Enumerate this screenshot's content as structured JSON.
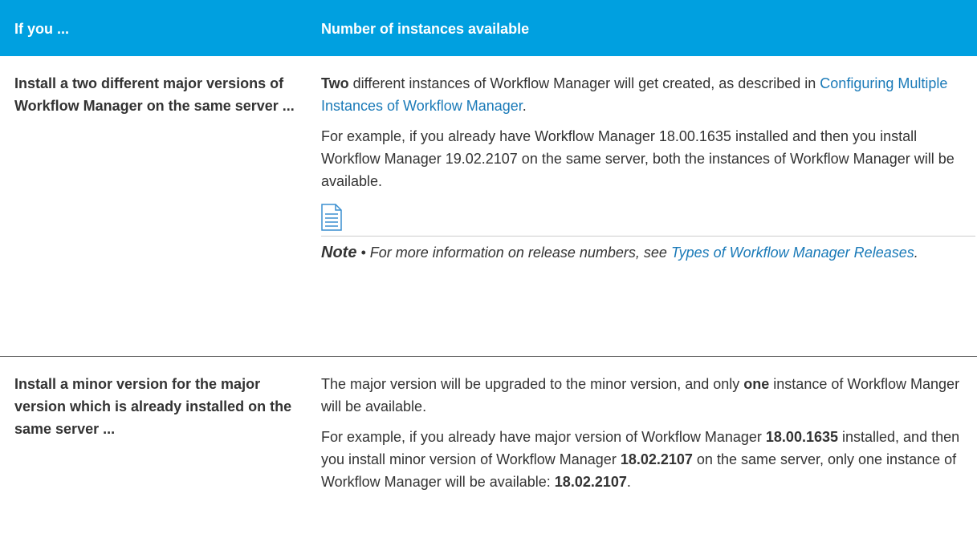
{
  "table": {
    "header": {
      "col1": "If you ...",
      "col2": "Number of instances available"
    },
    "rows": [
      {
        "condition": "Install a two different major versions of Workflow Manager on the same server ...",
        "p1_bold": "Two",
        "p1_text": " different instances of Workflow Manager will get created, as described in ",
        "p1_link": "Configuring Multiple Instances of Workflow Manager",
        "p1_end": ".",
        "p2": "For example, if you already have Workflow Manager 18.00.1635 installed and then you install Workflow Manager 19.02.2107 on the same server, both the instances of Workflow Manager will be available.",
        "note": {
          "icon": "note-document-icon",
          "label": "Note",
          "separator": " • ",
          "text": "For more information on release numbers, see ",
          "link": "Types of Workflow Manager Releases",
          "end": "."
        }
      },
      {
        "condition": "Install a minor version for the major version which is already installed on the same server ...",
        "p1_text": "The major version will be upgraded to the minor version, and only ",
        "p1_bold": "one",
        "p1_end": " instance of Workflow Manger will be available.",
        "p2_a": "For example, if you already have major version of Workflow Manager ",
        "p2_b1": "18.00.1635",
        "p2_c": " installed, and then you install minor version of Workflow Manager ",
        "p2_b2": "18.02.2107",
        "p2_d": " on the same server, only one instance of Workflow Manager will be available: ",
        "p2_b3": "18.02.2107",
        "p2_e": "."
      }
    ]
  },
  "colors": {
    "header_bg": "#00a0e0",
    "link": "#1a7ab8",
    "text": "#333333"
  }
}
